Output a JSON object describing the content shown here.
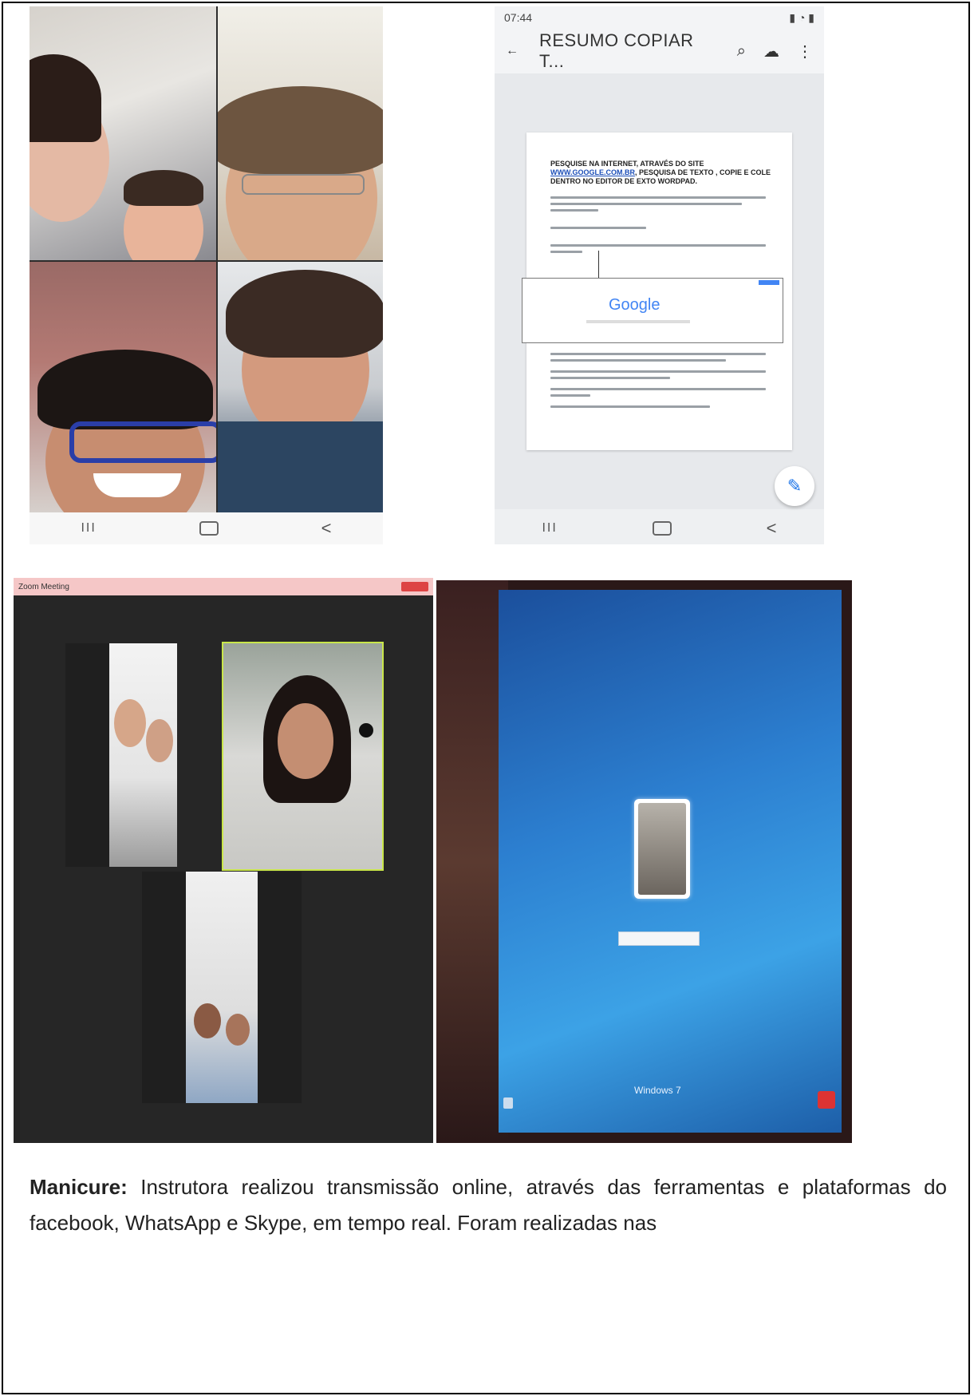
{
  "panels": {
    "video_grid": {
      "navbar": {
        "recent": "III",
        "back": "<"
      }
    },
    "phone_document": {
      "status_time": "07:44",
      "title": "RESUMO COPIAR T...",
      "doc_heading": "PESQUISE NA INTERNET, ATRAVÉS DO SITE",
      "doc_link": "WWW.GOOGLE.COM.BR",
      "doc_heading_cont": ", PESQUISA DE TEXTO , COPIE E COLE DENTRO NO EDITOR DE EXTO WORDPAD.",
      "google_logo": "Google",
      "navbar": {
        "recent": "III",
        "back": "<"
      }
    },
    "skype_call": {
      "window_title": "Zoom Meeting"
    },
    "laptop_login": {
      "windows_brand": "Windows 7"
    }
  },
  "caption": {
    "label": "Manicure:",
    "text": " Instrutora realizou transmissão online, através das ferramentas e plataformas do facebook, WhatsApp e Skype, em tempo real. Foram realizadas nas"
  }
}
